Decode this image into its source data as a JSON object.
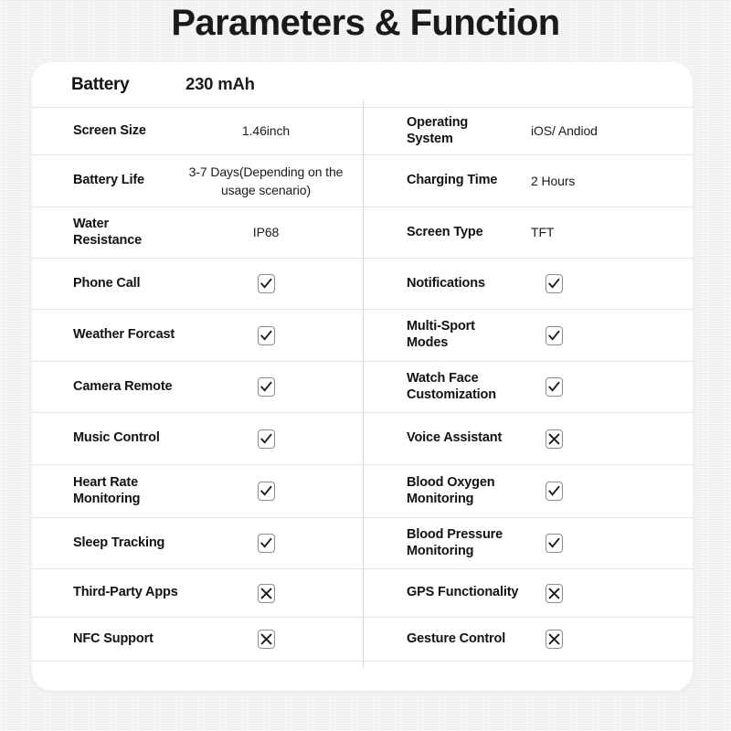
{
  "page": {
    "title": "Parameters & Function",
    "background_color": "#edeeee",
    "card_color": "#ffffff",
    "rule_color": "#e4e4e4",
    "text_color": "#121212",
    "mark_border_color": "#8c8c8c"
  },
  "hero": {
    "label": "Battery",
    "value": "230 mAh"
  },
  "rows": [
    {
      "left": {
        "label": "Screen Size",
        "value": "1.46inch",
        "type": "text"
      },
      "right": {
        "label": "Operating\nSystem",
        "value": "iOS/ Andiod",
        "type": "text"
      }
    },
    {
      "left": {
        "label": "Battery Life",
        "value": "3-7 Days(Depending on the usage scenario)",
        "type": "text"
      },
      "right": {
        "label": "Charging Time",
        "value": "2 Hours",
        "type": "text"
      }
    },
    {
      "left": {
        "label": "Water\nResistance",
        "value": "IP68",
        "type": "text"
      },
      "right": {
        "label": "Screen Type",
        "value": "TFT",
        "type": "text"
      }
    },
    {
      "left": {
        "label": "Phone Call",
        "value": "check",
        "type": "mark"
      },
      "right": {
        "label": "Notifications",
        "value": "check",
        "type": "mark"
      }
    },
    {
      "left": {
        "label": "Weather Forcast",
        "value": "check",
        "type": "mark"
      },
      "right": {
        "label": "Multi-Sport\nModes",
        "value": "check",
        "type": "mark"
      }
    },
    {
      "left": {
        "label": "Camera Remote",
        "value": "check",
        "type": "mark"
      },
      "right": {
        "label": "Watch Face\nCustomization",
        "value": "check",
        "type": "mark"
      }
    },
    {
      "left": {
        "label": "Music Control",
        "value": "check",
        "type": "mark"
      },
      "right": {
        "label": "Voice Assistant",
        "value": "cross",
        "type": "mark"
      }
    },
    {
      "left": {
        "label": "Heart Rate\nMonitoring",
        "value": "check",
        "type": "mark"
      },
      "right": {
        "label": "Blood Oxygen\nMonitoring",
        "value": "check",
        "type": "mark"
      }
    },
    {
      "left": {
        "label": "Sleep Tracking",
        "value": "check",
        "type": "mark"
      },
      "right": {
        "label": "Blood Pressure\nMonitoring",
        "value": "check",
        "type": "mark"
      }
    },
    {
      "left": {
        "label": "Third-Party Apps",
        "value": "cross",
        "type": "mark"
      },
      "right": {
        "label": "GPS Functionality",
        "value": "cross",
        "type": "mark"
      }
    },
    {
      "left": {
        "label": "NFC Support",
        "value": "cross",
        "type": "mark"
      },
      "right": {
        "label": "Gesture Control",
        "value": "cross",
        "type": "mark"
      }
    }
  ],
  "icons": {
    "check": "checkbox-checked-icon",
    "cross": "checkbox-crossed-icon"
  }
}
